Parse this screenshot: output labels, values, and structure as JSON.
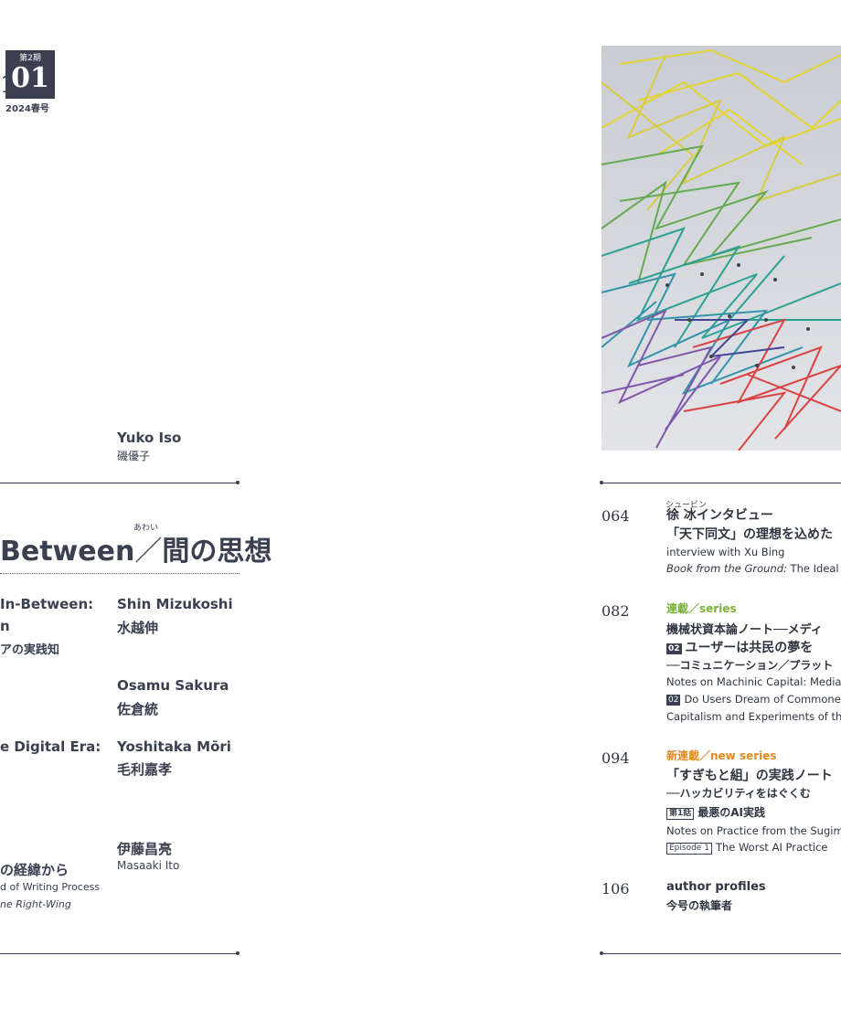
{
  "header": {
    "edge_fragment": "1",
    "issue_volume": "第2期",
    "issue_number": "01",
    "issue_date": "2024春号"
  },
  "left": {
    "top_author": {
      "name_en": "Yuko Iso",
      "name_jp": "磯優子"
    },
    "feature": {
      "title_en": "Between",
      "separator": "／",
      "title_jp": "間の思想",
      "ruby": "あわい"
    },
    "articles": [
      {
        "line1": "In-Between:",
        "line2": "n",
        "line3": "アの実践知",
        "author_en": "Shin Mizukoshi",
        "author_jp": "水越伸"
      },
      {
        "author_en": "Osamu Sakura",
        "author_jp": "佐倉統"
      },
      {
        "line1": "e Digital Era:",
        "author_en": "Yoshitaka Mōri",
        "author_jp": "毛利嘉孝"
      },
      {
        "line1": "の経緯から",
        "line2": "d of Writing Process",
        "line3": "ne Right-Wing",
        "author_jp": "伊藤昌亮",
        "author_en": "Masaaki Ito"
      }
    ]
  },
  "right": {
    "toc": [
      {
        "page": "064",
        "ruby": "シュービン",
        "title": "徐 冰インタビュー",
        "subtitle": "「天下同文」の理想を込めた",
        "en1": "interview with Xu Bing",
        "en2_italic": "Book from the Ground:",
        "en2_rest": " The Ideal of"
      },
      {
        "page": "082",
        "label": "連載／series",
        "title": "機械状資本論ノート──メディ",
        "badge": "02",
        "sub1": "ユーザーは共民の夢を",
        "sub2": "──コミュニケーション／プラット",
        "en1": "Notes on Machinic Capital: Media,",
        "en2": "Do Users Dream of Commone",
        "en3": "Capitalism and Experiments of the"
      },
      {
        "page": "094",
        "label": "新連載／new series",
        "title": "「すぎもと組」の実践ノート",
        "sub1": "──ハッカビリティをはぐくむ",
        "badge": "第1話",
        "sub2": "最悪のAI実践",
        "en1": "Notes on Practice from the Sugimo",
        "badge_en": "Episode 1",
        "en2": "The Worst AI Practice"
      },
      {
        "page": "106",
        "title": "author profiles",
        "subtitle": "今号の執筆者"
      }
    ]
  }
}
